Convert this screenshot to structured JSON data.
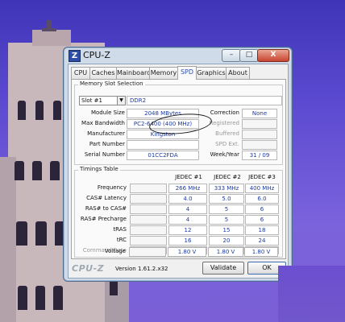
{
  "window": {
    "title": "CPU-Z",
    "icon_letter": "Z",
    "minimize": "–",
    "maximize": "□",
    "close": "X"
  },
  "tabs": [
    "CPU",
    "Caches",
    "Mainboard",
    "Memory",
    "SPD",
    "Graphics",
    "About"
  ],
  "active_tab": "SPD",
  "memory_slot": {
    "group_title": "Memory Slot Selection",
    "slot": "Slot #1",
    "type": "DDR2",
    "rows": [
      {
        "label": "Module Size",
        "value": "2048 MBytes"
      },
      {
        "label": "Max Bandwidth",
        "value": "PC2-6400 (400 MHz)"
      },
      {
        "label": "Manufacturer",
        "value": "Kingston"
      },
      {
        "label": "Part Number",
        "value": ""
      },
      {
        "label": "Serial Number",
        "value": "01CC2FDA"
      }
    ],
    "right_rows": [
      {
        "label": "Correction",
        "value": "None",
        "dim": false
      },
      {
        "label": "Registered",
        "value": "",
        "dim": true
      },
      {
        "label": "Buffered",
        "value": "",
        "dim": true
      },
      {
        "label": "SPD Ext.",
        "value": "",
        "dim": true
      },
      {
        "label": "Week/Year",
        "value": "31 / 09",
        "dim": false
      }
    ]
  },
  "timings": {
    "group_title": "Timings Table",
    "columns": [
      "JEDEC #1",
      "JEDEC #2",
      "JEDEC #3"
    ],
    "rows": [
      {
        "label": "Frequency",
        "values": [
          "266 MHz",
          "333 MHz",
          "400 MHz"
        ],
        "dim": false
      },
      {
        "label": "CAS# Latency",
        "values": [
          "4.0",
          "5.0",
          "6.0"
        ],
        "dim": false
      },
      {
        "label": "RAS# to CAS#",
        "values": [
          "4",
          "5",
          "6"
        ],
        "dim": false
      },
      {
        "label": "RAS# Precharge",
        "values": [
          "4",
          "5",
          "6"
        ],
        "dim": false
      },
      {
        "label": "tRAS",
        "values": [
          "12",
          "15",
          "18"
        ],
        "dim": false
      },
      {
        "label": "tRC",
        "values": [
          "16",
          "20",
          "24"
        ],
        "dim": false
      },
      {
        "label": "Command Rate",
        "values": [
          "",
          "",
          ""
        ],
        "dim": true
      },
      {
        "label": "Voltage",
        "values": [
          "1.80 V",
          "1.80 V",
          "1.80 V"
        ],
        "dim": false
      }
    ]
  },
  "footer": {
    "brand": "CPU-Z",
    "version": "Version 1.61.2.x32",
    "validate": "Validate",
    "ok": "OK"
  }
}
